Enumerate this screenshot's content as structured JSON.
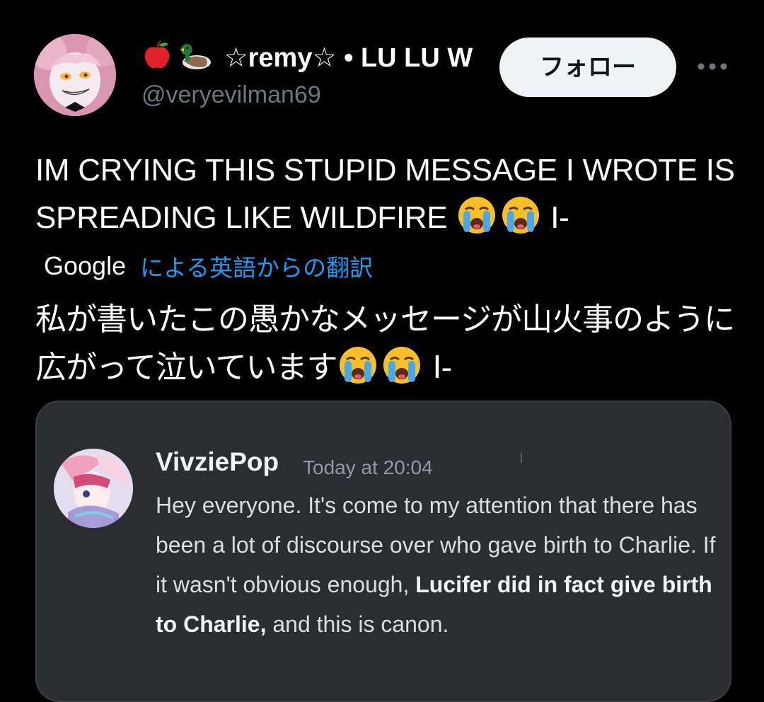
{
  "header": {
    "display_name": "☆remy☆ • LU LU W",
    "name_icons": [
      "apple-icon",
      "duck-icon"
    ],
    "handle": "@veryevilman69",
    "follow_label": "フォロー",
    "more_icon": "more-icon"
  },
  "tweet": {
    "text": "IM CRYING THIS STUPID MESSAGE I WROTE IS SPREADING LIKE WILDFIRE",
    "emoji": "loudly-crying-face",
    "suffix": "I-"
  },
  "translation": {
    "provider": "Google",
    "link_label": "による英語からの翻訳",
    "text": "私が書いたこの愚かなメッセージが山火事のように広がって泣いています",
    "suffix": "I-"
  },
  "quoted_message": {
    "username": "VivziePop",
    "timestamp": "Today at 20:04",
    "text_part1": "Hey everyone. It's come to my attention that there has been a lot of discourse over who gave birth to Charlie. If it wasn't obvious enough,",
    "text_bold": "Lucifer did in fact give birth to Charlie,",
    "text_part2": "and this is canon."
  },
  "colors": {
    "background": "#000000",
    "text": "#ffffff",
    "muted": "#71767b",
    "link": "#1d9bf0",
    "follow_bg": "#eff3f4",
    "discord_bg": "#2b2d31"
  }
}
